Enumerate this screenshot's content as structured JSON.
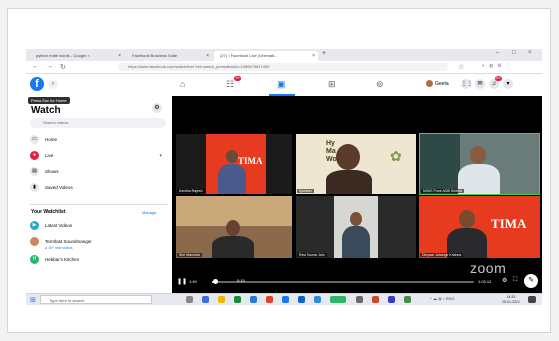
{
  "browser": {
    "tabs": [
      {
        "label": "python mate words - Google ×"
      },
      {
        "label": "Facebook Business Suite"
      },
      {
        "label": "(27) • Facebook Live (Orientati..."
      }
    ],
    "new_tab_label": "+",
    "url": "https://www.facebook.com/watch/live/?ref=watch_permalink&v=1089875617453"
  },
  "facebook": {
    "logo": "f",
    "tooltip": "Press Esc for Home",
    "profile_name": "Geeta",
    "notifications": {
      "home": "",
      "friends": "9+",
      "messenger": "",
      "bell": "20+"
    }
  },
  "sidebar": {
    "title": "Watch",
    "search_placeholder": "Search videos",
    "items": [
      {
        "label": "Home",
        "icon": "tv-icon"
      },
      {
        "label": "Live",
        "icon": "live-icon"
      },
      {
        "label": "Shows",
        "icon": "clapper-icon"
      },
      {
        "label": "Saved Videos",
        "icon": "bookmark-icon"
      }
    ],
    "watchlist_title": "Your Watchlist",
    "manage_label": "Manage",
    "watchlist": [
      {
        "label": "Latest Videos",
        "sub": ""
      },
      {
        "label": "Termfast Soundmanger",
        "sub": "● 10+ new videos"
      },
      {
        "label": "Hebbar's Kitchen",
        "sub": ""
      }
    ]
  },
  "video": {
    "participants": [
      {
        "name": "Kavitha Rajesh"
      },
      {
        "name": "Speaker"
      },
      {
        "name": "NSKK Pune AOB Sridhar"
      },
      {
        "name": "Shri Manohar"
      },
      {
        "name": "Ravi Kumar Jain"
      },
      {
        "name": "Dinyaar Jahangir Krishna"
      }
    ],
    "slide_lines": [
      "Hy",
      "Ma      st",
      "Wo  ce"
    ],
    "banner_text": "TIMA",
    "zoom_watermark": "zoom",
    "time_current": "1:49",
    "time_total": "1:03:12",
    "duration_hint": "0:15",
    "progress": 0.01
  },
  "taskbar": {
    "search_placeholder": "Type here to search",
    "time": "14:33",
    "date": "25-01-2021",
    "lang": "ENG"
  }
}
